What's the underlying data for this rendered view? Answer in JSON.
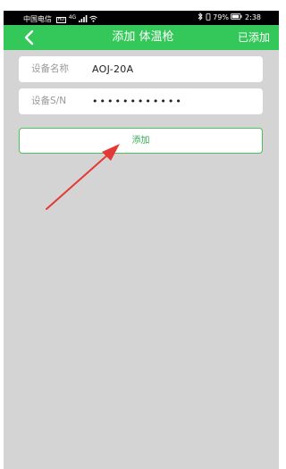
{
  "status_bar": {
    "carrier": "中国电信",
    "network": "4G",
    "battery_percent": "79%",
    "time": "2:38"
  },
  "nav": {
    "back_icon": "chevron-left-icon",
    "title": "添加 体温枪",
    "action_label": "已添加"
  },
  "form": {
    "device_name_label": "设备名称",
    "device_name_value": "AOJ-20A",
    "device_sn_label": "设备S/N",
    "device_sn_value": "••••••••••••"
  },
  "add_button": {
    "label": "添加"
  },
  "colors": {
    "nav_green": "#34c759",
    "button_border": "#4cbf5f",
    "arrow_red": "#e53935",
    "screen_bg": "#d4d4d4"
  }
}
